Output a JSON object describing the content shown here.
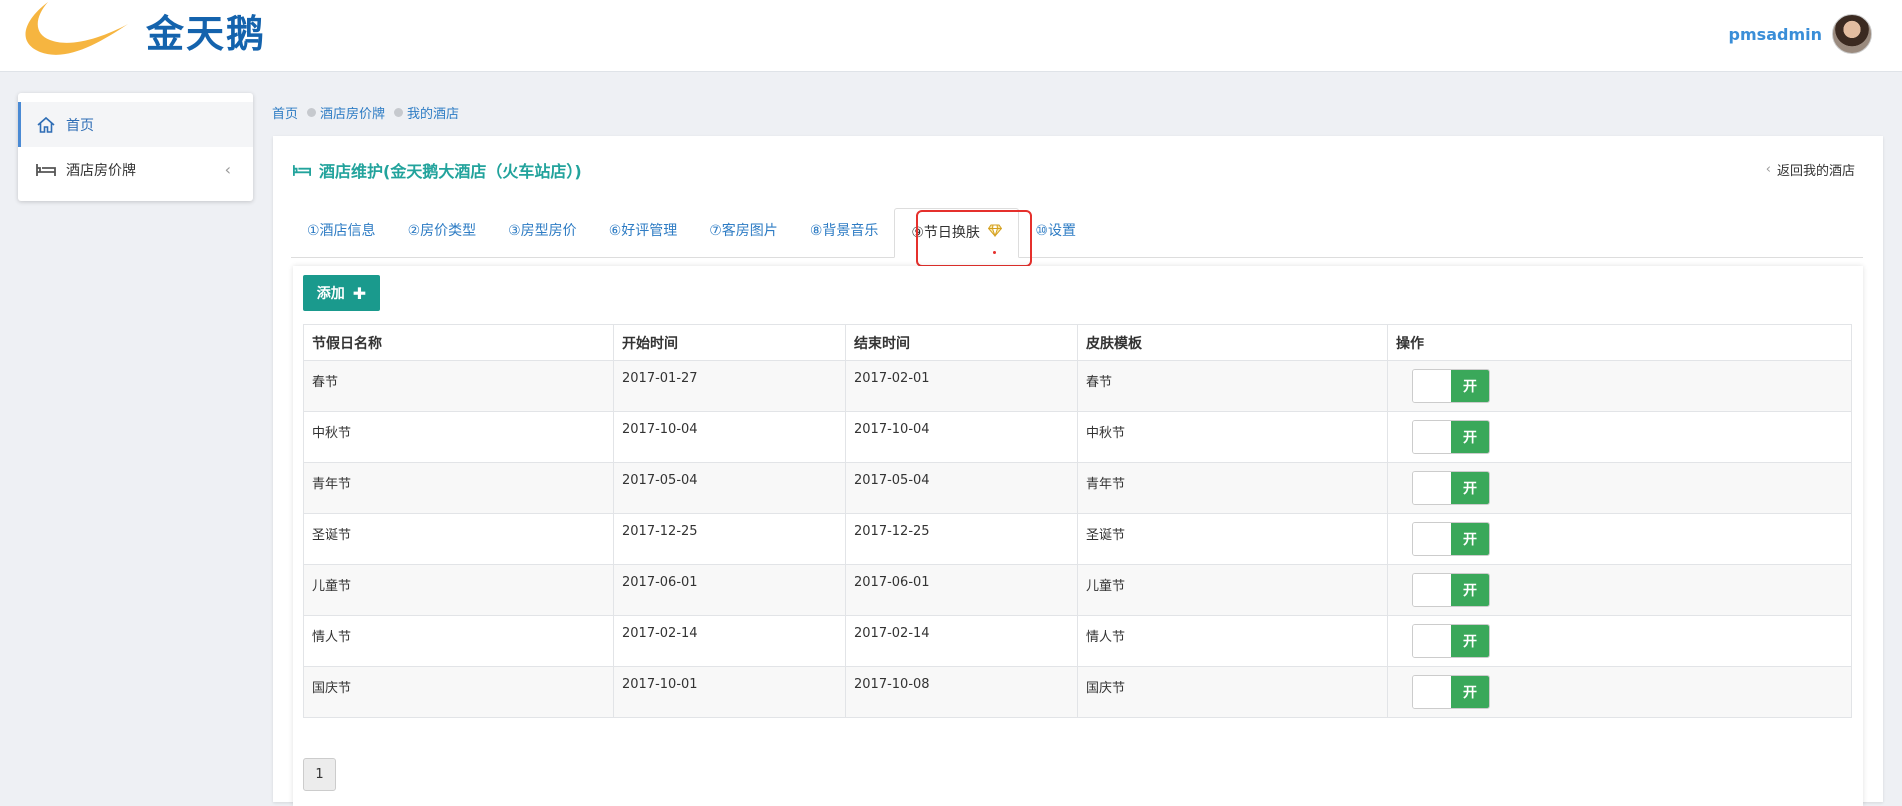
{
  "brand": {
    "name": "金天鹅",
    "color": "#1463ad",
    "swoosh_color": "#f6b540"
  },
  "user": {
    "name": "pmsadmin"
  },
  "sidebar": {
    "items": [
      {
        "label": "首页",
        "icon": "home-icon",
        "active": true
      },
      {
        "label": "酒店房价牌",
        "icon": "bed-icon",
        "active": false
      }
    ]
  },
  "breadcrumb": [
    "首页",
    "酒店房价牌",
    "我的酒店"
  ],
  "panel": {
    "title": "酒店维护(金天鹅大酒店（火车站店）)",
    "back_label": "返回我的酒店"
  },
  "tabs": [
    {
      "label": "①酒店信息"
    },
    {
      "label": "②房价类型"
    },
    {
      "label": "③房型房价"
    },
    {
      "label": "⑥好评管理"
    },
    {
      "label": "⑦客房图片"
    },
    {
      "label": "⑧背景音乐"
    },
    {
      "label": "⑨节日换肤",
      "active": true,
      "icon": "diamond-icon"
    },
    {
      "label": "⑩设置"
    }
  ],
  "toolbar": {
    "add_label": "添加"
  },
  "table": {
    "headers": [
      "节假日名称",
      "开始时间",
      "结束时间",
      "皮肤模板",
      "操作"
    ],
    "rows": [
      {
        "name": "春节",
        "start": "2017-01-27",
        "end": "2017-02-01",
        "skin": "春节",
        "toggle": "开"
      },
      {
        "name": "中秋节",
        "start": "2017-10-04",
        "end": "2017-10-04",
        "skin": "中秋节",
        "toggle": "开"
      },
      {
        "name": "青年节",
        "start": "2017-05-04",
        "end": "2017-05-04",
        "skin": "青年节",
        "toggle": "开"
      },
      {
        "name": "圣诞节",
        "start": "2017-12-25",
        "end": "2017-12-25",
        "skin": "圣诞节",
        "toggle": "开"
      },
      {
        "name": "儿童节",
        "start": "2017-06-01",
        "end": "2017-06-01",
        "skin": "儿童节",
        "toggle": "开"
      },
      {
        "name": "情人节",
        "start": "2017-02-14",
        "end": "2017-02-14",
        "skin": "情人节",
        "toggle": "开"
      },
      {
        "name": "国庆节",
        "start": "2017-10-01",
        "end": "2017-10-08",
        "skin": "国庆节",
        "toggle": "开"
      }
    ]
  },
  "pagination": {
    "current": "1"
  },
  "colors": {
    "accent_teal": "#1a9a8d",
    "toggle_on": "#3aa85a",
    "highlight": "#e5302c",
    "link": "#2e7cc4"
  }
}
